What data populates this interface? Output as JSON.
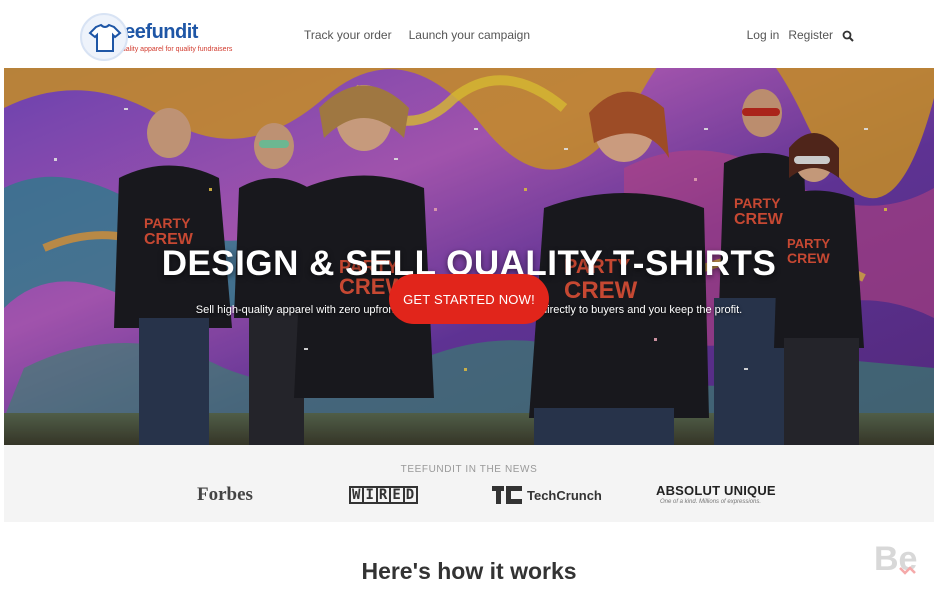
{
  "brand": {
    "name": "teefundit",
    "tagline": "quality apparel for quality fundraisers"
  },
  "nav": {
    "left_items": [
      "Track your order",
      "Launch your campaign"
    ],
    "login": "Log in",
    "register": "Register"
  },
  "hero": {
    "title": "DESIGN & SELL QUALITY T-SHIRTS",
    "subtitle": "Sell high-quality apparel with zero upfront costs and zero risk. We ship directly to buyers and you keep the profit.",
    "cta": "GET STARTED NOW!",
    "shirt_text": "PARTY CREW"
  },
  "press": {
    "title": "TEEFUNDIT IN THE NEWS",
    "logos": {
      "forbes": "Forbes",
      "wired": "WIRED",
      "techcrunch": "TechCrunch",
      "absolut_main": "ABSOLUT UNIQUE",
      "absolut_small": "One of a kind. Millions of expressions."
    }
  },
  "how": {
    "title": "Here's how it works"
  },
  "badge": {
    "text": "Be"
  },
  "colors": {
    "accent": "#e1251b",
    "brand_blue": "#1e56a6",
    "press_bg": "#f4f4f4"
  }
}
